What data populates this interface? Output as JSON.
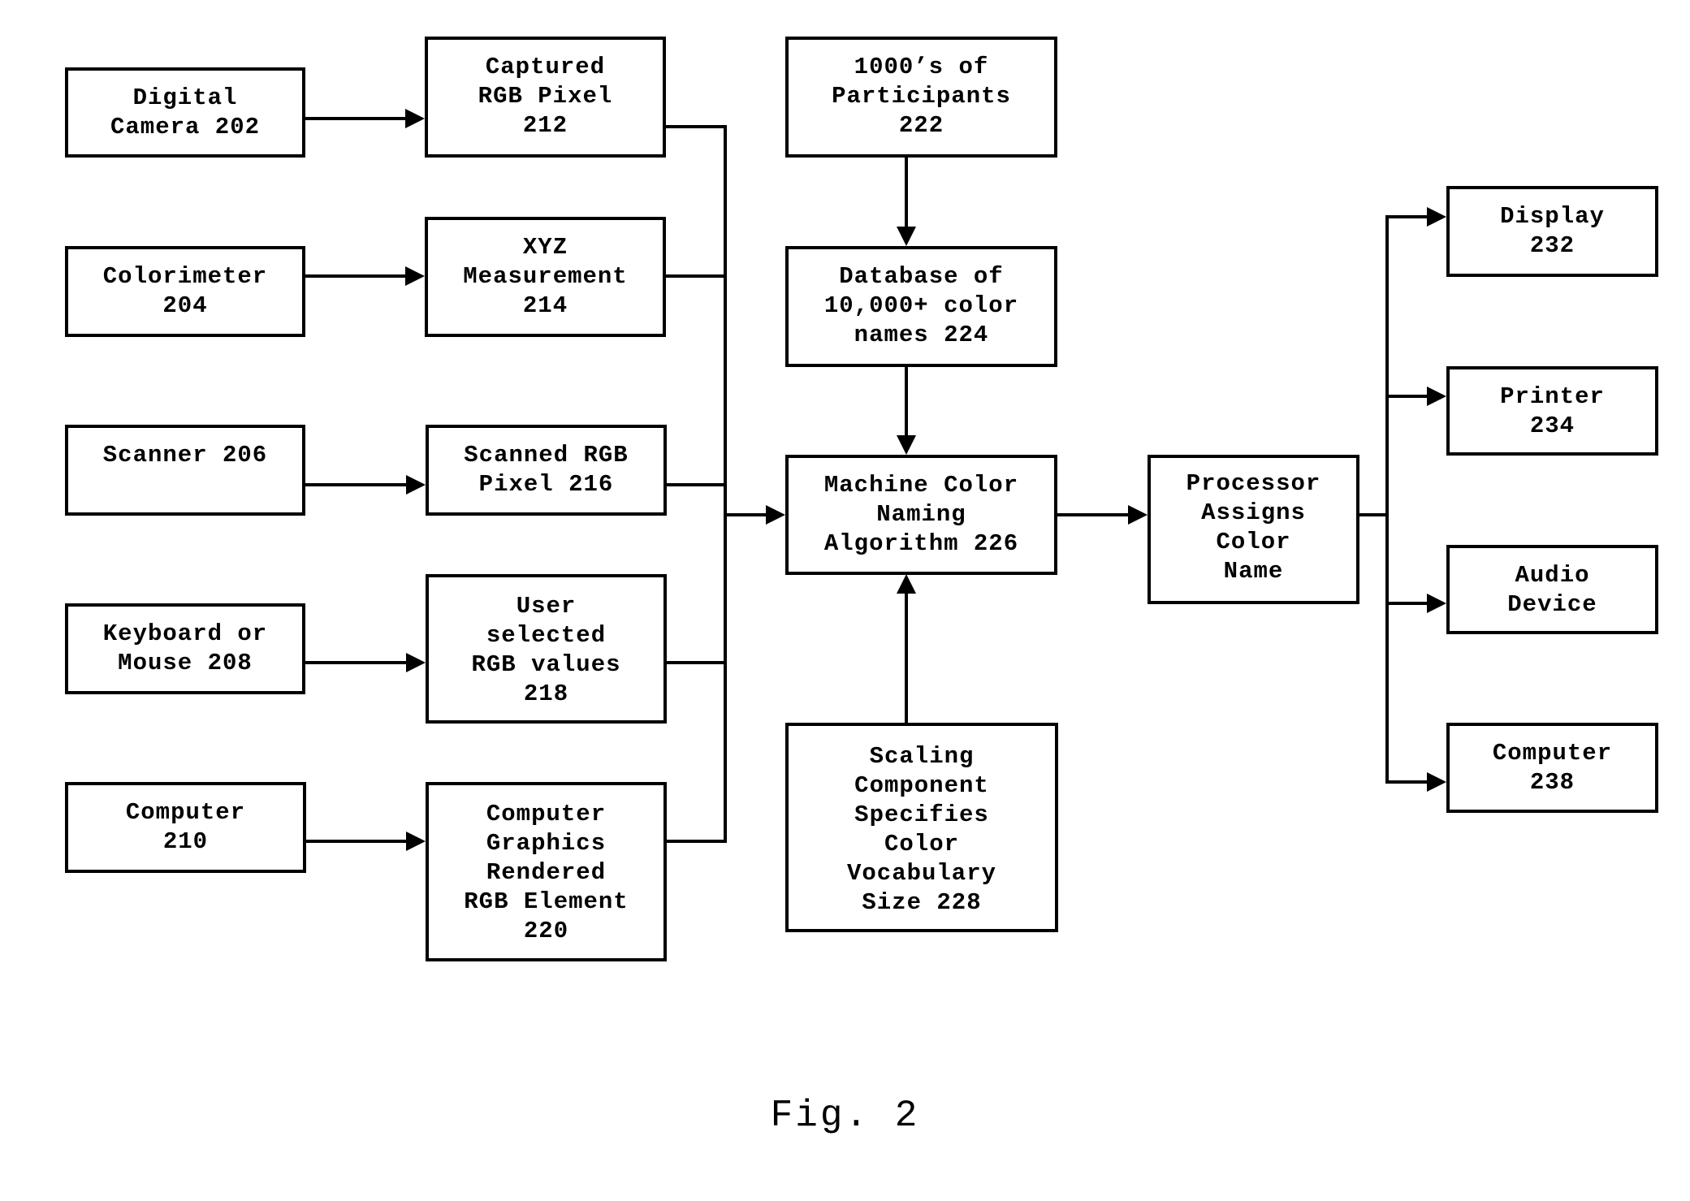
{
  "figure": {
    "caption": "Fig. 2"
  },
  "nodes": {
    "n202": "Digital\nCamera 202",
    "n204": "Colorimeter\n204",
    "n206": "Scanner 206",
    "n208": "Keyboard or\nMouse 208",
    "n210": "Computer\n210",
    "n212": "Captured\nRGB Pixel\n212",
    "n214": "XYZ\nMeasurement\n214",
    "n216": "Scanned RGB\nPixel 216",
    "n218": "User\nselected\nRGB values\n218",
    "n220": "Computer\nGraphics\nRendered\nRGB Element\n220",
    "n222": "1000’s of\nParticipants\n222",
    "n224": "Database of\n10,000+ color\nnames 224",
    "n226": "Machine Color\nNaming\nAlgorithm 226",
    "n228": "Scaling\nComponent\nSpecifies\nColor\nVocabulary\nSize 228",
    "n230": "Processor\nAssigns\nColor\nName",
    "n232": "Display\n232",
    "n234": "Printer\n234",
    "n236": "Audio\nDevice",
    "n238": "Computer\n238"
  },
  "edges": [
    {
      "from": "Digital Camera 202",
      "to": "Captured RGB Pixel 212"
    },
    {
      "from": "Colorimeter 204",
      "to": "XYZ Measurement 214"
    },
    {
      "from": "Scanner 206",
      "to": "Scanned RGB Pixel 216"
    },
    {
      "from": "Keyboard or Mouse 208",
      "to": "User selected RGB values 218"
    },
    {
      "from": "Computer 210",
      "to": "Computer Graphics Rendered RGB Element 220"
    },
    {
      "from": "Captured/XYZ/Scanned/User/CG (bus)",
      "to": "Machine Color Naming Algorithm 226"
    },
    {
      "from": "1000's of Participants 222",
      "to": "Database of 10,000+ color names 224"
    },
    {
      "from": "Database of 10,000+ color names 224",
      "to": "Machine Color Naming Algorithm 226"
    },
    {
      "from": "Scaling Component Specifies Color Vocabulary Size 228",
      "to": "Machine Color Naming Algorithm 226"
    },
    {
      "from": "Machine Color Naming Algorithm 226",
      "to": "Processor Assigns Color Name"
    },
    {
      "from": "Processor Assigns Color Name",
      "to": "Display 232"
    },
    {
      "from": "Processor Assigns Color Name",
      "to": "Printer 234"
    },
    {
      "from": "Processor Assigns Color Name",
      "to": "Audio Device"
    },
    {
      "from": "Processor Assigns Color Name",
      "to": "Computer 238"
    }
  ]
}
